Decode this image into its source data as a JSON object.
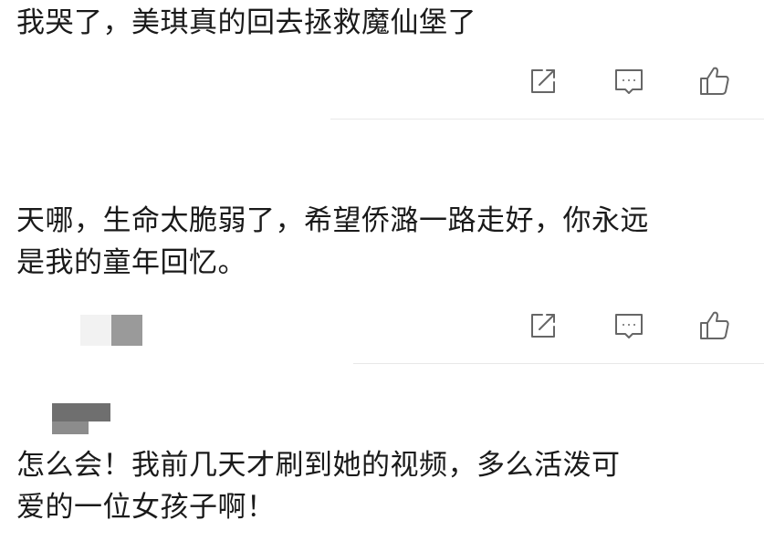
{
  "comments": [
    {
      "text": "我哭了，美琪真的回去拯救魔仙堡了"
    },
    {
      "text": "天哪，生命太脆弱了，希望侨潞一路走好，你永远\n是我的童年回忆。"
    },
    {
      "text": "怎么会！我前几天才刷到她的视频，多么活泼可\n爱的一位女孩子啊！"
    }
  ],
  "icons": {
    "share": "share-edit-icon",
    "reply": "comment-icon",
    "like": "thumbs-up-icon"
  },
  "colors": {
    "text": "#1a1a1a",
    "icon": "#666666",
    "divider": "#e8e8e8"
  }
}
